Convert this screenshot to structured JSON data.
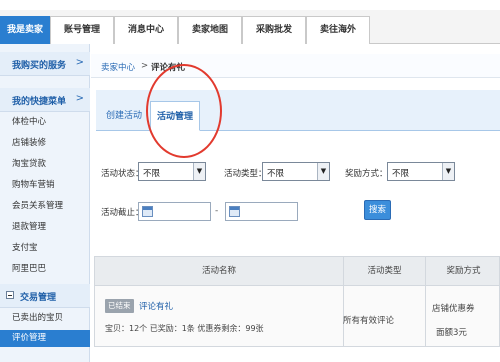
{
  "topnav": {
    "tabs": [
      "我是卖家",
      "账号管理",
      "消息中心",
      "卖家地图",
      "采购批发",
      "卖往海外"
    ],
    "active_index": 0
  },
  "sidebar": {
    "section1": {
      "label": "我购买的服务",
      "arrow": ">"
    },
    "section2": {
      "label": "我的快捷菜单",
      "arrow": ">",
      "items": [
        "体检中心",
        "店铺装修",
        "淘宝贷款",
        "购物车营销",
        "会员关系管理",
        "退款管理",
        "支付宝",
        "阿里巴巴"
      ]
    },
    "section3": {
      "label": "交易管理",
      "icon": "minus-icon",
      "items": [
        "已卖出的宝贝",
        "评价管理"
      ],
      "selected_index": 1
    }
  },
  "breadcrumb": {
    "root": "卖家中心",
    "sep": ">",
    "current": "评论有礼"
  },
  "subtabs": {
    "items": [
      "创建活动",
      "活动管理"
    ],
    "active_index": 1
  },
  "filters": {
    "status": {
      "label": "活动状态：",
      "value": "不限"
    },
    "type": {
      "label": "活动类型：",
      "value": "不限"
    },
    "reward": {
      "label": "奖励方式：",
      "value": "不限"
    },
    "deadline": {
      "label": "活动截止：",
      "sep": "-"
    },
    "search_label": "搜索"
  },
  "table": {
    "headers": [
      "活动名称",
      "活动类型",
      "奖励方式"
    ],
    "row": {
      "badge": "已结束",
      "name": "评论有礼",
      "detail": "宝贝：12个   已奖励：1条   优惠券剩余：99张",
      "type": "所有有效评论",
      "reward_line1": "店铺优惠券",
      "reward_line2": "面额3元"
    }
  },
  "colors": {
    "accent": "#2a7ed0",
    "highlight_circle": "#e23a2e"
  }
}
